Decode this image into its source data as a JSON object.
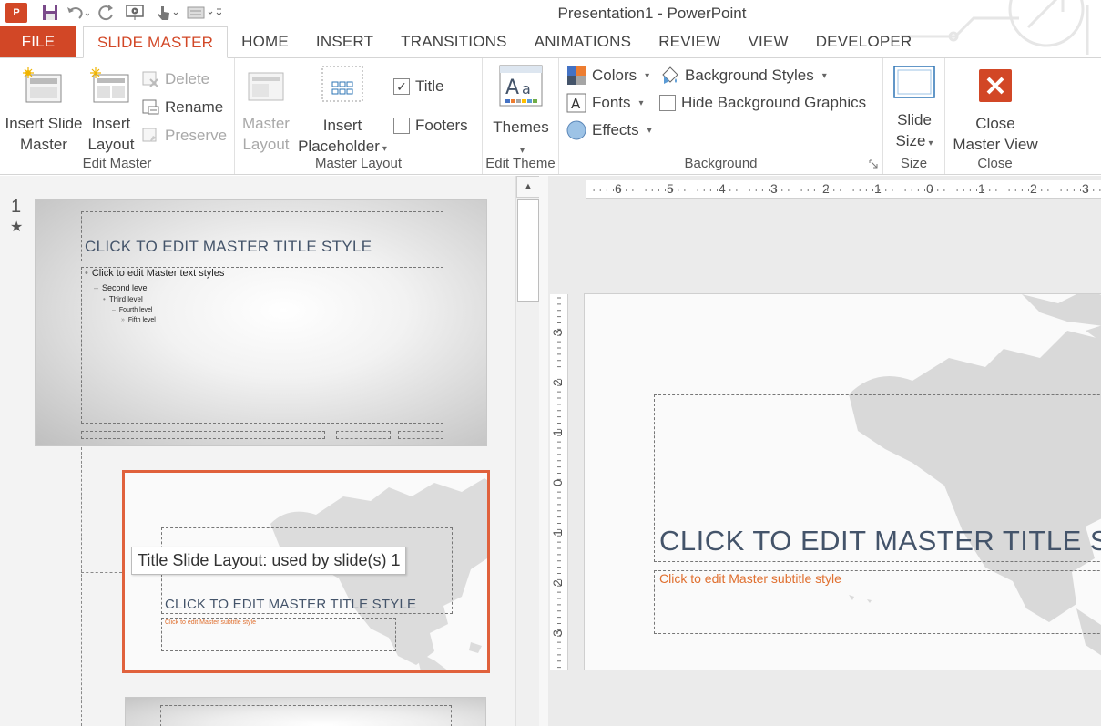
{
  "window": {
    "title": "Presentation1 - PowerPoint",
    "app_icon": "P"
  },
  "tabs": [
    {
      "label": "FILE"
    },
    {
      "label": "SLIDE MASTER"
    },
    {
      "label": "HOME"
    },
    {
      "label": "INSERT"
    },
    {
      "label": "TRANSITIONS"
    },
    {
      "label": "ANIMATIONS"
    },
    {
      "label": "REVIEW"
    },
    {
      "label": "VIEW"
    },
    {
      "label": "DEVELOPER"
    }
  ],
  "ribbon": {
    "edit_master": {
      "label": "Edit Master",
      "insert_slide_master": [
        "Insert Slide",
        "Master"
      ],
      "insert_layout": [
        "Insert",
        "Layout"
      ],
      "delete": "Delete",
      "rename": "Rename",
      "preserve": "Preserve"
    },
    "master_layout": {
      "label": "Master Layout",
      "master_layout_btn": [
        "Master",
        "Layout"
      ],
      "insert_placeholder": [
        "Insert",
        "Placeholder"
      ],
      "title_check": "Title",
      "title_checked": true,
      "footers_check": "Footers",
      "footers_checked": false
    },
    "edit_theme": {
      "label": "Edit Theme",
      "themes": "Themes"
    },
    "background": {
      "label": "Background",
      "colors": "Colors",
      "fonts": "Fonts",
      "effects": "Effects",
      "background_styles": "Background Styles",
      "hide_background_graphics": "Hide Background Graphics"
    },
    "size": {
      "label": "Size",
      "slide_size": [
        "Slide",
        "Size"
      ]
    },
    "close": {
      "label": "Close",
      "close_master_view": [
        "Close",
        "Master View"
      ]
    }
  },
  "thumbnails": {
    "master_number": "1",
    "master_title": "CLICK TO EDIT MASTER TITLE STYLE",
    "levels": [
      "Click to edit Master text styles",
      "Second level",
      "Third level",
      "Fourth level",
      "Fifth level"
    ],
    "layout_title": "CLICK TO EDIT MASTER TITLE STYLE",
    "layout_subtitle": "Click to edit Master subtitle style",
    "tooltip": "Title Slide Layout: used by slide(s) 1"
  },
  "editor": {
    "title": "CLICK TO EDIT MASTER TITLE STYLE",
    "subtitle": "Click to edit Master subtitle style",
    "hruler_labels": [
      "6",
      "5",
      "4",
      "3",
      "2",
      "1",
      "0",
      "1",
      "2",
      "3"
    ],
    "vruler_labels": [
      "3",
      "2",
      "1",
      "0",
      "1",
      "2",
      "3"
    ]
  },
  "colors": {
    "accent": "#d24726",
    "selection": "#e0613c",
    "title_text": "#44546a",
    "subtitle_text": "#e07030"
  }
}
